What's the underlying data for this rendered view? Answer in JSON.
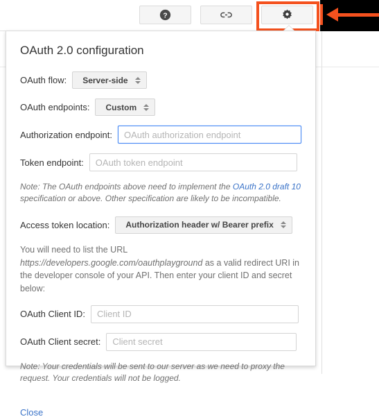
{
  "toolbar": {
    "buttons": [
      {
        "name": "help",
        "icon": "question-mark-circle-icon",
        "tooltip": "Help"
      },
      {
        "name": "link",
        "icon": "link-chain-icon",
        "tooltip": "Share / Link"
      },
      {
        "name": "settings",
        "icon": "gear-icon",
        "tooltip": "Configuration"
      }
    ]
  },
  "annotation": {
    "arrow_color": "#f4511e",
    "highlight_color": "#f4511e",
    "band_color": "#000000",
    "points_to": "settings-gear-button"
  },
  "panel": {
    "title": "OAuth 2.0 configuration",
    "fields": {
      "oauth_flow": {
        "label": "OAuth flow:",
        "value": "Server-side"
      },
      "oauth_endpoints": {
        "label": "OAuth endpoints:",
        "value": "Custom"
      },
      "authorization_endpoint": {
        "label": "Authorization endpoint:",
        "placeholder": "OAuth authorization endpoint",
        "value": "",
        "focused": true
      },
      "token_endpoint": {
        "label": "Token endpoint:",
        "placeholder": "OAuth token endpoint",
        "value": "",
        "focused": false
      },
      "access_token_location": {
        "label": "Access token location:",
        "value": "Authorization header w/ Bearer prefix"
      },
      "oauth_client_id": {
        "label": "OAuth Client ID:",
        "placeholder": "Client ID",
        "value": "",
        "focused": false
      },
      "oauth_client_secret": {
        "label": "OAuth Client secret:",
        "placeholder": "Client secret",
        "value": "",
        "focused": false
      }
    },
    "endpoints_note": {
      "before_link": "Note: The OAuth endpoints above need to implement the ",
      "link_text": "OAuth 2.0 draft 10",
      "after_link": " specification or above. Other specification are likely to be incompatible."
    },
    "redirect_paragraph": {
      "before_url": "You will need to list the URL ",
      "url": "https://developers.google.com/oauthplayground",
      "after_url": " as a valid redirect URI in the developer console of your API. Then enter your client ID and secret below:"
    },
    "credentials_note": "Note: Your credentials will be sent to our server as we need to proxy the request. Your credentials will not be logged.",
    "close_label": "Close"
  }
}
